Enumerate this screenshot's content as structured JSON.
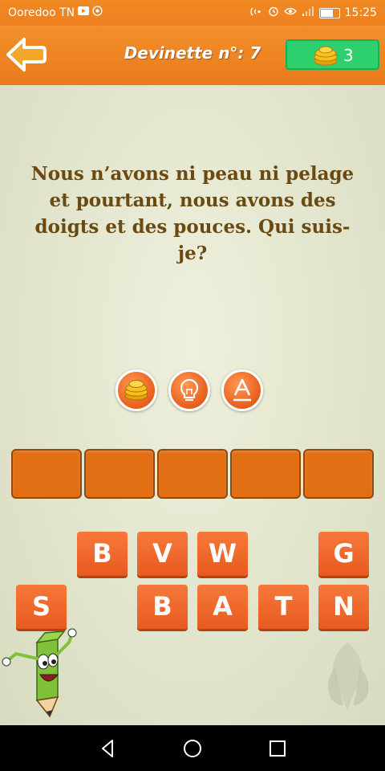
{
  "status_bar": {
    "carrier": "Ooredoo TN",
    "time": "15:25",
    "battery_level": 0.75
  },
  "header": {
    "title": "Devinette n°: 7",
    "coins": "3"
  },
  "question": "Nous n’avons ni peau ni pelage et pourtant, nous avons des doigts et des pouces. Qui suis-je?",
  "hints": [
    {
      "name": "coins-hint",
      "icon": "coin-stack-icon"
    },
    {
      "name": "lightbulb-hint",
      "icon": "lightbulb-icon"
    },
    {
      "name": "letter-hint",
      "icon": "letter-a-icon",
      "label": "A"
    }
  ],
  "answer_slots": [
    "",
    "",
    "",
    "",
    ""
  ],
  "letters_row1": [
    "B",
    "V",
    "W",
    "G"
  ],
  "letters_row2": [
    "S",
    "B",
    "A",
    "T",
    "N"
  ],
  "colors": {
    "header": "#ef8420",
    "coins_badge": "#2dd06c",
    "key": "#ee6a2c",
    "slot": "#e26f14",
    "question_text": "#6b4a12"
  }
}
